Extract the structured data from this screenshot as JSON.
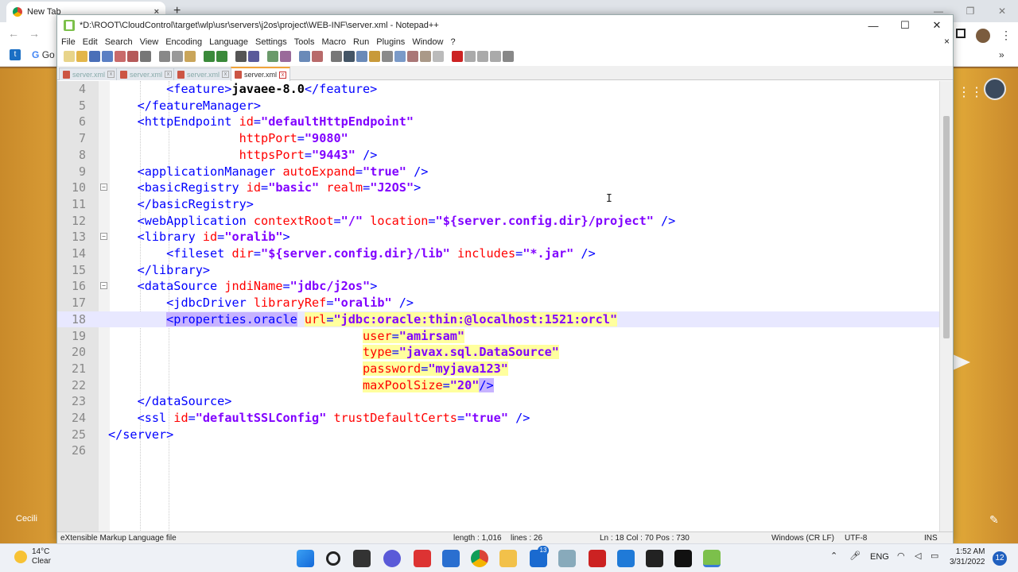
{
  "browser": {
    "tab_title": "New Tab",
    "tab_close": "×",
    "new_tab": "+",
    "bookmark_label": "Go",
    "bottom_left_label": "Cecili"
  },
  "npp": {
    "title": "*D:\\ROOT\\CloudControl\\target\\wlp\\usr\\servers\\j2os\\project\\WEB-INF\\server.xml - Notepad++",
    "window_buttons": [
      "—",
      "☐",
      "✕"
    ],
    "menu": [
      "File",
      "Edit",
      "Search",
      "View",
      "Encoding",
      "Language",
      "Settings",
      "Tools",
      "Macro",
      "Run",
      "Plugins",
      "Window",
      "?"
    ],
    "menu_close": "×",
    "tabs": [
      {
        "label": "server.xml",
        "active": false
      },
      {
        "label": "server.xml",
        "active": false
      },
      {
        "label": "server.xml",
        "active": false
      },
      {
        "label": "server.xml",
        "active": true
      }
    ],
    "editor": {
      "current_line": 18,
      "lines": [
        {
          "n": "4",
          "fold": "",
          "tokens": [
            [
              "ws",
              "        "
            ],
            [
              "t",
              "<feature>"
            ],
            [
              "x",
              "javaee-8.0"
            ],
            [
              "t",
              "</feature>"
            ]
          ]
        },
        {
          "n": "5",
          "fold": "",
          "tokens": [
            [
              "ws",
              "    "
            ],
            [
              "t",
              "</featureManager>"
            ]
          ]
        },
        {
          "n": "6",
          "fold": "",
          "tokens": [
            [
              "ws",
              "    "
            ],
            [
              "t",
              "<httpEndpoint "
            ],
            [
              "a",
              "id"
            ],
            [
              "t",
              "="
            ],
            [
              "v",
              "\"defaultHttpEndpoint\""
            ]
          ]
        },
        {
          "n": "7",
          "fold": "",
          "tokens": [
            [
              "ws",
              "                  "
            ],
            [
              "a",
              "httpPort"
            ],
            [
              "t",
              "="
            ],
            [
              "v",
              "\"9080\""
            ]
          ]
        },
        {
          "n": "8",
          "fold": "",
          "tokens": [
            [
              "ws",
              "                  "
            ],
            [
              "a",
              "httpsPort"
            ],
            [
              "t",
              "="
            ],
            [
              "v",
              "\"9443\""
            ],
            [
              "t",
              " />"
            ]
          ]
        },
        {
          "n": "9",
          "fold": "",
          "tokens": [
            [
              "ws",
              "    "
            ],
            [
              "t",
              "<applicationManager "
            ],
            [
              "a",
              "autoExpand"
            ],
            [
              "t",
              "="
            ],
            [
              "v",
              "\"true\""
            ],
            [
              "t",
              " />"
            ]
          ]
        },
        {
          "n": "10",
          "fold": "⊟",
          "tokens": [
            [
              "ws",
              "    "
            ],
            [
              "t",
              "<basicRegistry "
            ],
            [
              "a",
              "id"
            ],
            [
              "t",
              "="
            ],
            [
              "v",
              "\"basic\""
            ],
            [
              "t",
              " "
            ],
            [
              "a",
              "realm"
            ],
            [
              "t",
              "="
            ],
            [
              "v",
              "\"J2OS\""
            ],
            [
              "t",
              ">"
            ]
          ]
        },
        {
          "n": "11",
          "fold": "",
          "tokens": [
            [
              "ws",
              "    "
            ],
            [
              "t",
              "</basicRegistry>"
            ]
          ]
        },
        {
          "n": "12",
          "fold": "",
          "tokens": [
            [
              "ws",
              "    "
            ],
            [
              "t",
              "<webApplication "
            ],
            [
              "a",
              "contextRoot"
            ],
            [
              "t",
              "="
            ],
            [
              "v",
              "\"/\""
            ],
            [
              "t",
              " "
            ],
            [
              "a",
              "location"
            ],
            [
              "t",
              "="
            ],
            [
              "v",
              "\"${server.config.dir}/project\""
            ],
            [
              "t",
              " />"
            ]
          ]
        },
        {
          "n": "13",
          "fold": "⊟",
          "tokens": [
            [
              "ws",
              "    "
            ],
            [
              "t",
              "<library "
            ],
            [
              "a",
              "id"
            ],
            [
              "t",
              "="
            ],
            [
              "v",
              "\"oralib\""
            ],
            [
              "t",
              ">"
            ]
          ]
        },
        {
          "n": "14",
          "fold": "",
          "tokens": [
            [
              "ws",
              "        "
            ],
            [
              "t",
              "<fileset "
            ],
            [
              "a",
              "dir"
            ],
            [
              "t",
              "="
            ],
            [
              "v",
              "\"${server.config.dir}/lib\""
            ],
            [
              "t",
              " "
            ],
            [
              "a",
              "includes"
            ],
            [
              "t",
              "="
            ],
            [
              "v",
              "\"*.jar\""
            ],
            [
              "t",
              " />"
            ]
          ]
        },
        {
          "n": "15",
          "fold": "",
          "tokens": [
            [
              "ws",
              "    "
            ],
            [
              "t",
              "</library>"
            ]
          ]
        },
        {
          "n": "16",
          "fold": "⊟",
          "tokens": [
            [
              "ws",
              "    "
            ],
            [
              "t",
              "<dataSource "
            ],
            [
              "a",
              "jndiName"
            ],
            [
              "t",
              "="
            ],
            [
              "v",
              "\"jdbc/j2os\""
            ],
            [
              "t",
              ">"
            ]
          ]
        },
        {
          "n": "17",
          "fold": "",
          "tokens": [
            [
              "ws",
              "        "
            ],
            [
              "t",
              "<jdbcDriver "
            ],
            [
              "a",
              "libraryRef"
            ],
            [
              "t",
              "="
            ],
            [
              "v",
              "\"oralib\""
            ],
            [
              "t",
              " />"
            ]
          ]
        },
        {
          "n": "18",
          "fold": "",
          "tokens": [
            [
              "ws",
              "        "
            ],
            [
              "sel",
              "<properties.oracle"
            ],
            [
              "ws",
              " "
            ],
            [
              "hla",
              "url"
            ],
            [
              "hlt",
              "="
            ],
            [
              "hlv",
              "\"jdbc:oracle:thin:@localhost:1521:orcl\""
            ]
          ]
        },
        {
          "n": "19",
          "fold": "",
          "tokens": [
            [
              "ws",
              "                                   "
            ],
            [
              "hla",
              "user"
            ],
            [
              "hlt",
              "="
            ],
            [
              "hlv",
              "\"amirsam\""
            ]
          ]
        },
        {
          "n": "20",
          "fold": "",
          "tokens": [
            [
              "ws",
              "                                   "
            ],
            [
              "hla",
              "type"
            ],
            [
              "hlt",
              "="
            ],
            [
              "hlv",
              "\"javax.sql.DataSource\""
            ]
          ]
        },
        {
          "n": "21",
          "fold": "",
          "tokens": [
            [
              "ws",
              "                                   "
            ],
            [
              "hla",
              "password"
            ],
            [
              "hlt",
              "="
            ],
            [
              "hlv",
              "\"myjava123\""
            ]
          ]
        },
        {
          "n": "22",
          "fold": "",
          "tokens": [
            [
              "ws",
              "                                   "
            ],
            [
              "hla",
              "maxPoolSize"
            ],
            [
              "hlt",
              "="
            ],
            [
              "hlv",
              "\"20\""
            ],
            [
              "selt",
              "/>"
            ]
          ]
        },
        {
          "n": "23",
          "fold": "",
          "tokens": [
            [
              "ws",
              "    "
            ],
            [
              "t",
              "</dataSource>"
            ]
          ]
        },
        {
          "n": "24",
          "fold": "",
          "tokens": [
            [
              "ws",
              "    "
            ],
            [
              "t",
              "<ssl "
            ],
            [
              "a",
              "id"
            ],
            [
              "t",
              "="
            ],
            [
              "v",
              "\"defaultSSLConfig\""
            ],
            [
              "t",
              " "
            ],
            [
              "a",
              "trustDefaultCerts"
            ],
            [
              "t",
              "="
            ],
            [
              "v",
              "\"true\""
            ],
            [
              "t",
              " />"
            ]
          ]
        },
        {
          "n": "25",
          "fold": "",
          "tokens": [
            [
              "t",
              "</server>"
            ]
          ]
        },
        {
          "n": "26",
          "fold": "",
          "tokens": []
        }
      ]
    },
    "status": {
      "file_type": "eXtensible Markup Language file",
      "length": "length : 1,016",
      "lines": "lines : 26",
      "position": "Ln : 18    Col : 70    Pos : 730",
      "eol": "Windows (CR LF)",
      "encoding": "UTF-8",
      "mode": "INS"
    }
  },
  "taskbar": {
    "temp": "14°C",
    "weather": "Clear",
    "lang": "ENG",
    "time": "1:52 AM",
    "date": "3/31/2022",
    "notifications": "12",
    "badge": "13"
  }
}
